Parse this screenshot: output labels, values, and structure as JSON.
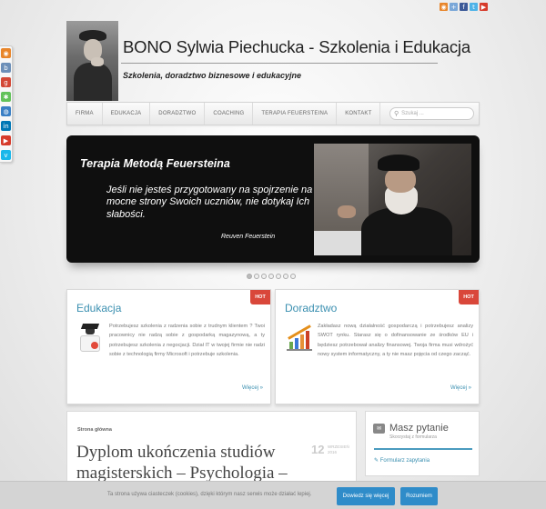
{
  "social_top": {
    "items": [
      {
        "icon": "rss-icon",
        "color": "#e8862b",
        "glyph": "◉"
      },
      {
        "icon": "share-icon",
        "color": "#7aa7d8",
        "glyph": "+"
      },
      {
        "icon": "facebook-icon",
        "color": "#3b5998",
        "glyph": "f"
      },
      {
        "icon": "twitter-icon",
        "color": "#4fb3e8",
        "glyph": "t"
      },
      {
        "icon": "youtube-icon",
        "color": "#d63b2b",
        "glyph": "▶"
      }
    ]
  },
  "social_left": {
    "items": [
      {
        "icon": "rss-icon",
        "color": "#e8862b",
        "glyph": "◉"
      },
      {
        "icon": "blogger-icon",
        "color": "#6c8fb8",
        "glyph": "b"
      },
      {
        "icon": "google-plus-icon",
        "color": "#d34836",
        "glyph": "g"
      },
      {
        "icon": "delicious-icon",
        "color": "#62c25a",
        "glyph": "✱"
      },
      {
        "icon": "globe-icon",
        "color": "#3a7fc4",
        "glyph": "◍"
      },
      {
        "icon": "linkedin-icon",
        "color": "#0077b5",
        "glyph": "in"
      },
      {
        "icon": "youtube-icon",
        "color": "#d63b2b",
        "glyph": "▶"
      },
      {
        "icon": "vimeo-icon",
        "color": "#1ab7ea",
        "glyph": "v"
      }
    ]
  },
  "header": {
    "title": "BONO Sylwia Piechucka - Szkolenia i Edukacja",
    "tagline": "Szkolenia, doradztwo biznesowe i edukacyjne"
  },
  "nav": {
    "items": [
      "FIRMA",
      "EDUKACJA",
      "DORADZTWO",
      "COACHING",
      "TERAPIA FEUERSTEINA",
      "KONTAKT"
    ],
    "search_placeholder": "Szukaj ..."
  },
  "slider": {
    "title": "Terapia Metodą Feuersteina",
    "quote": "Jeśli nie jesteś przygotowany na spojrzenie na mocne strony Swoich uczniów, nie dotykaj Ich słabości.",
    "author": "Reuven Feuerstein",
    "dots_count": 7,
    "active_dot": 0
  },
  "cards": [
    {
      "title": "Edukacja",
      "badge": "HOT",
      "text": "Potrzebujesz szkolenia z radzenia sobie z trudnym klientem ? Twoi pracownicy nie radzą sobie z gospodarką magazynową, a ty potrzebujesz szkolenia z negocjacji. Dział IT w twojej firmie nie radzi sobie z technologią firmy Microsoft i potrzebuje szkolenia.",
      "more": "Więcej »"
    },
    {
      "title": "Doradztwo",
      "badge": "HOT",
      "text": "Zakładasz nową działalność gospodarczą i potrzebujesz analizy SWOT rynku. Starasz się o dofinansowanie ze środków EU i będziesz potrzebował analizy finansowej. Twoja firma musi wdrożyć nowy system informatyczny, a ty nie masz pojęcia od czego zacząć.",
      "more": "Więcej »"
    }
  ],
  "article": {
    "breadcrumb": "Strona główna",
    "title": "Dyplom ukończenia studiów magisterskich – Psychologia – Specjalność",
    "date_day": "12",
    "date_month": "WRZESIEŃ",
    "date_year": "2016"
  },
  "widget": {
    "title": "Masz pytanie",
    "subtitle": "Skorzystaj z formularza",
    "link": "Formularz zapytania"
  },
  "cookie": {
    "text": "Ta strona używa ciasteczek (cookies), dzięki którym nasz serwis może działać lepiej.",
    "more_button": "Dowiedz się więcej",
    "ok_button": "Rozumiem"
  },
  "colors": {
    "accent": "#3a8fb0",
    "hot_badge": "#d9473a",
    "cookie_button": "#2f8cc9"
  }
}
